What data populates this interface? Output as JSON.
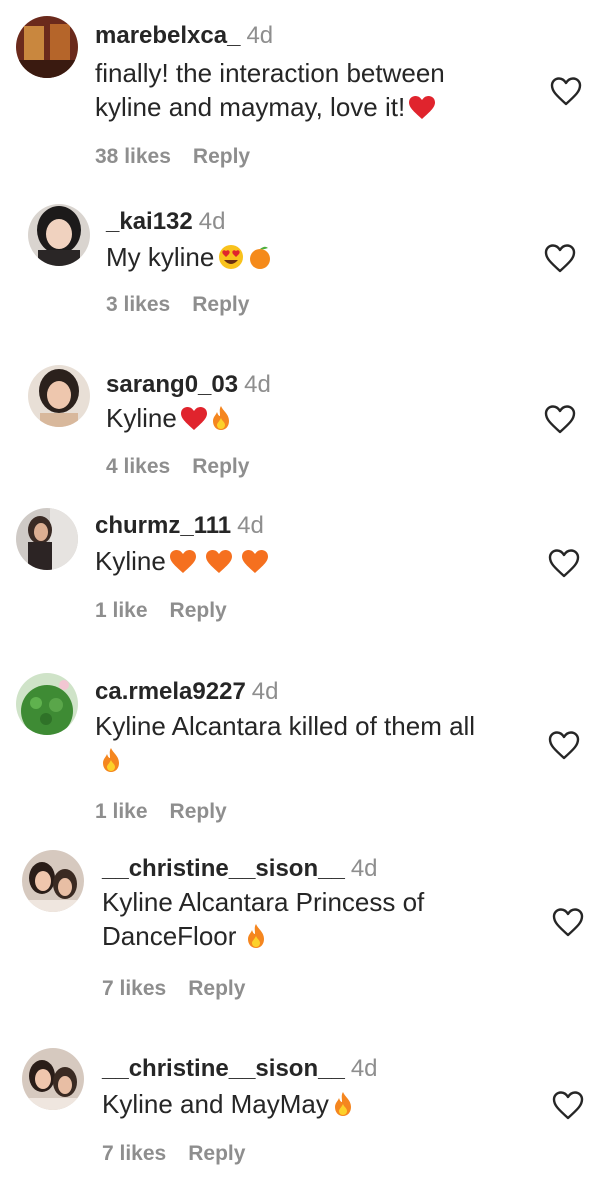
{
  "comments": [
    {
      "username": "marebelxca_",
      "time": "4d",
      "lines": [
        "finally! the interaction between",
        "kyline and maymay, love it!"
      ],
      "emojis": [
        "red-heart"
      ],
      "likes": "38 likes",
      "reply": "Reply"
    },
    {
      "username": "_kai132",
      "time": "4d",
      "lines": [
        "My kyline"
      ],
      "emojis": [
        "heart-eyes",
        "tangerine"
      ],
      "likes": "3 likes",
      "reply": "Reply"
    },
    {
      "username": "sarang0_03",
      "time": "4d",
      "lines": [
        "Kyline"
      ],
      "emojis": [
        "red-heart",
        "fire"
      ],
      "likes": "4 likes",
      "reply": "Reply"
    },
    {
      "username": "churmz_111",
      "time": "4d",
      "lines": [
        "Kyline"
      ],
      "emojis": [
        "orange-heart",
        "orange-heart",
        "orange-heart"
      ],
      "likes": "1 like",
      "reply": "Reply"
    },
    {
      "username": "ca.rmela9227",
      "time": "4d",
      "lines": [
        "Kyline Alcantara killed of them all",
        ""
      ],
      "emojis": [
        "fire"
      ],
      "likes": "1 like",
      "reply": "Reply"
    },
    {
      "username": "__christine__sison__",
      "time": "4d",
      "lines": [
        "Kyline Alcantara Princess of",
        "DanceFloor"
      ],
      "emojis": [
        "fire"
      ],
      "likes": "7 likes",
      "reply": "Reply"
    },
    {
      "username": "__christine__sison__",
      "time": "4d",
      "lines": [
        "Kyline and MayMay"
      ],
      "emojis": [
        "fire"
      ],
      "likes": "7 likes",
      "reply": "Reply"
    }
  ]
}
